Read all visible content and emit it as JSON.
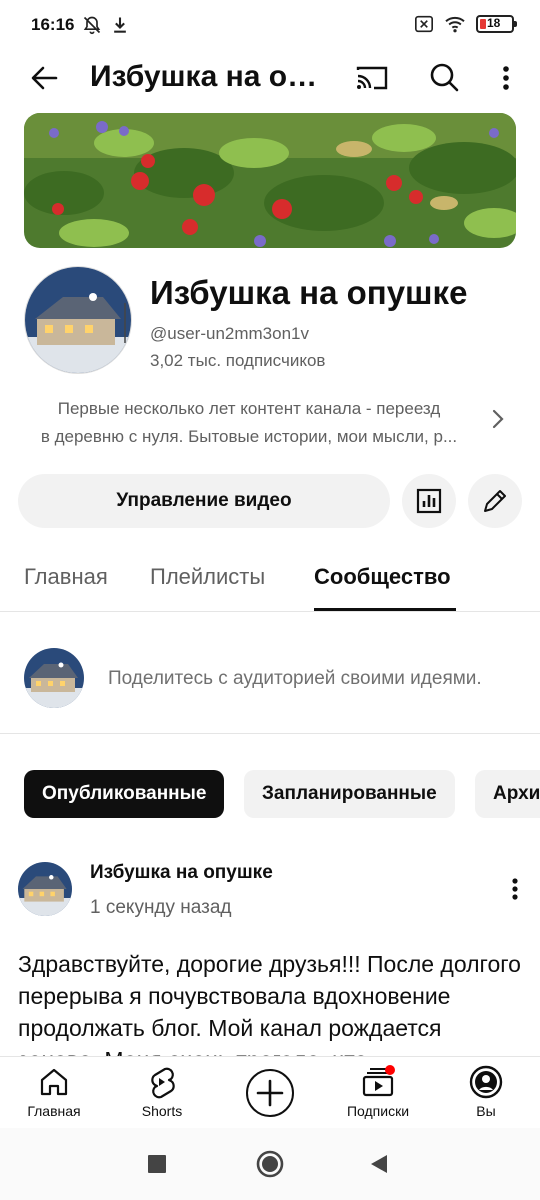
{
  "status_bar": {
    "time": "16:16",
    "battery": "18",
    "icons": [
      "bell-off-icon",
      "download-icon",
      "close-box-icon",
      "wifi-icon",
      "battery-icon"
    ]
  },
  "app_bar": {
    "title": "Избушка на опушке",
    "icons": [
      "back-arrow-icon",
      "cast-icon",
      "search-icon",
      "more-vert-icon"
    ]
  },
  "channel": {
    "name": "Избушка на опушке",
    "handle": "@user-un2mm3on1v",
    "subscribers": "3,02 тыс. подписчиков",
    "description_line1": "Первые несколько лет контент канала - переезд",
    "description_line2": "в деревню с нуля. Бытовые истории, мои мысли, р..."
  },
  "actions": {
    "manage_videos": "Управление видео",
    "icons": [
      "analytics-icon",
      "edit-pencil-icon"
    ]
  },
  "tabs": [
    {
      "label": "Главная",
      "active": false
    },
    {
      "label": "Плейлисты",
      "active": false
    },
    {
      "label": "Сообщество",
      "active": true
    }
  ],
  "composer": {
    "placeholder": "Поделитесь с аудиторией своими идеями."
  },
  "chips": [
    {
      "label": "Опубликованные",
      "active": true
    },
    {
      "label": "Запланированные",
      "active": false
    },
    {
      "label": "Архи",
      "active": false
    }
  ],
  "post": {
    "author": "Избушка на опушке",
    "time": "1 секунду назад",
    "body": "Здравствуйте, дорогие друзья!!! После долгого перерыва я почувствовала вдохновение продолжать блог. Мой канал рождается заново. Меня очень трогало, что"
  },
  "bottom_nav": [
    {
      "label": "Главная",
      "icon": "home-icon"
    },
    {
      "label": "Shorts",
      "icon": "shorts-icon"
    },
    {
      "label": "",
      "icon": "create-plus-icon"
    },
    {
      "label": "Подписки",
      "icon": "subscriptions-icon"
    },
    {
      "label": "Вы",
      "icon": "account-icon"
    }
  ],
  "colors": {
    "accent": "#0f0f0f",
    "secondary_text": "#606060",
    "chip_bg": "#f2f2f2",
    "notification_dot": "#ff0000",
    "battery_low": "#e53935"
  }
}
